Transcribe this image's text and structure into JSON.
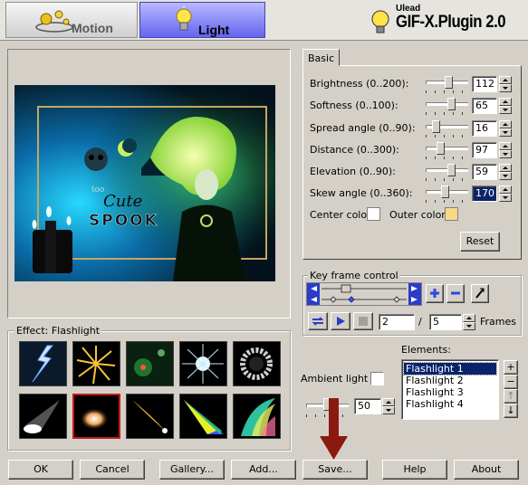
{
  "tabs": {
    "motion": "Motion",
    "light": "Light"
  },
  "brand": {
    "small": "Ulead",
    "big": "GIF-X.Plugin 2.0"
  },
  "effect_label": "Effect: Flashlight",
  "basic": {
    "tab": "Basic",
    "params": [
      {
        "label": "Brightness (0..200):",
        "value": "112",
        "level": 0.56
      },
      {
        "label": "Softness (0..100):",
        "value": "65",
        "level": 0.65
      },
      {
        "label": "Spread angle (0..90):",
        "value": "16",
        "level": 0.18
      },
      {
        "label": "Distance (0..300):",
        "value": "97",
        "level": 0.32
      },
      {
        "label": "Elevation (0..90):",
        "value": "59",
        "level": 0.66
      },
      {
        "label": "Skew angle (0..360):",
        "value": "170",
        "level": 0.47
      }
    ],
    "center_color_label": "Center color:",
    "outer_color_label": "Outer color:",
    "center_color": "#ffffff",
    "outer_color": "#fad88a",
    "reset_label": "Reset"
  },
  "keyframe": {
    "title": "Key frame control",
    "current_frame": "2",
    "separator": "/",
    "total_frames": "5",
    "frames_label": "Frames"
  },
  "ambient": {
    "label": "Ambient light",
    "value": "50",
    "level": 0.5
  },
  "elements": {
    "label": "Elements:",
    "items": [
      "Flashlight 1",
      "Flashlight 2",
      "Flashlight 3",
      "Flashlight 4"
    ],
    "selected": "Flashlight 1"
  },
  "preview": {
    "text1": "too",
    "text2": "Cute",
    "text3": "SPOOK"
  },
  "buttons": {
    "ok": "OK",
    "cancel": "Cancel",
    "gallery": "Gallery...",
    "add": "Add...",
    "save": "Save...",
    "help": "Help",
    "about": "About"
  }
}
